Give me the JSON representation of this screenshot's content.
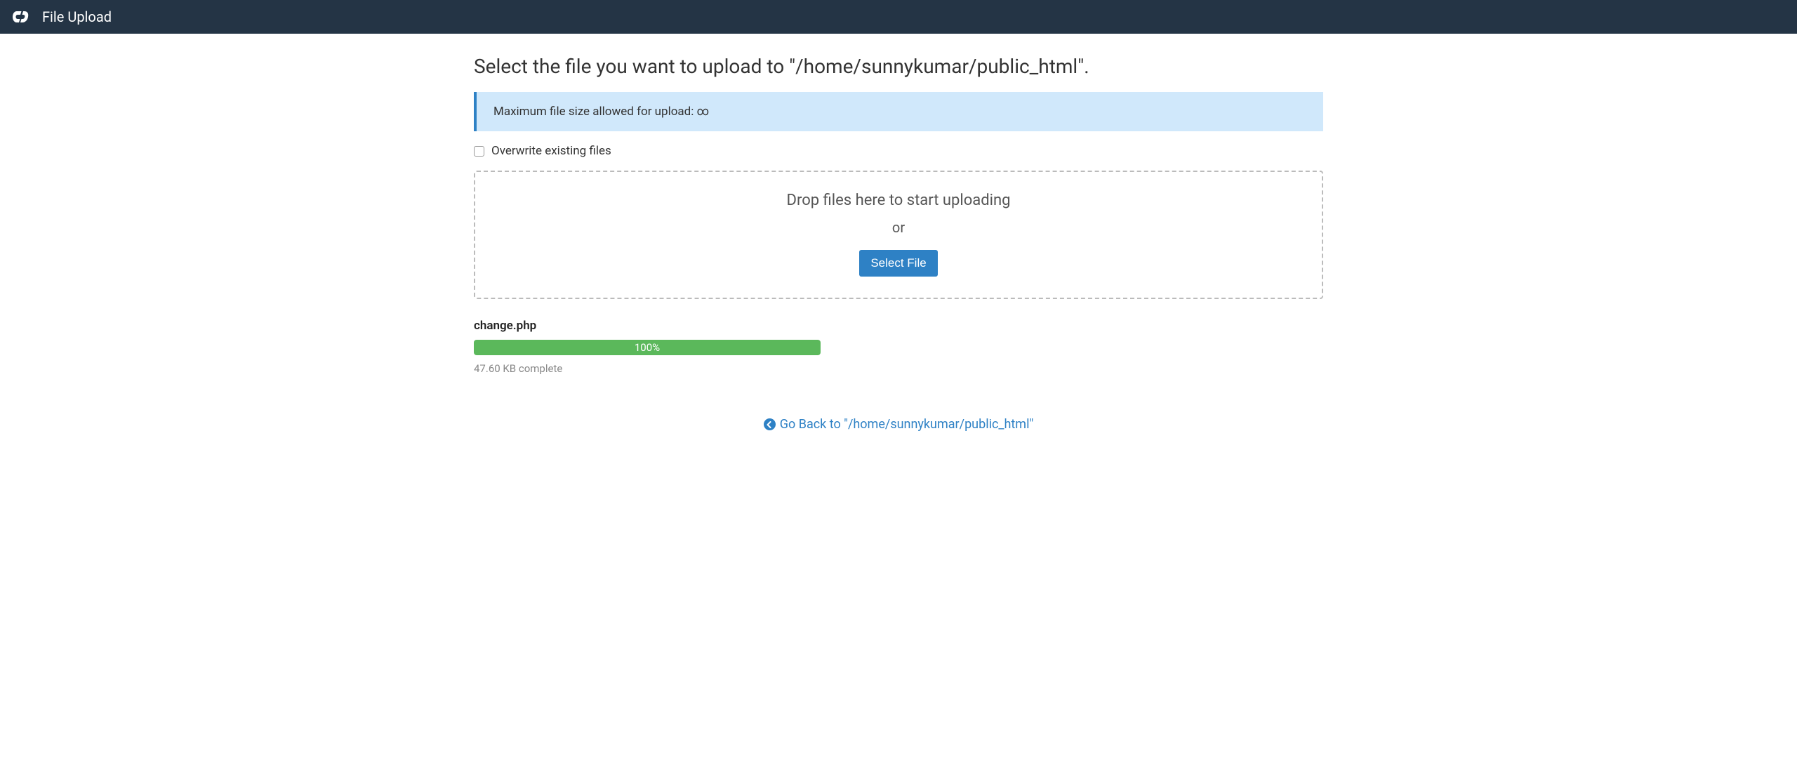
{
  "header": {
    "title": "File Upload"
  },
  "main": {
    "page_title": "Select the file you want to upload to \"/home/sunnykumar/public_html\".",
    "info_banner": "Maximum file size allowed for upload: ∞",
    "overwrite_label": "Overwrite existing files",
    "dropzone": {
      "drop_text": "Drop files here to start uploading",
      "or_text": "or",
      "button_label": "Select File"
    },
    "upload": {
      "filename": "change.php",
      "progress_label": "100%",
      "progress_percent": 100,
      "status_text": "47.60 KB complete"
    },
    "back_link": "Go Back to \"/home/sunnykumar/public_html\""
  }
}
